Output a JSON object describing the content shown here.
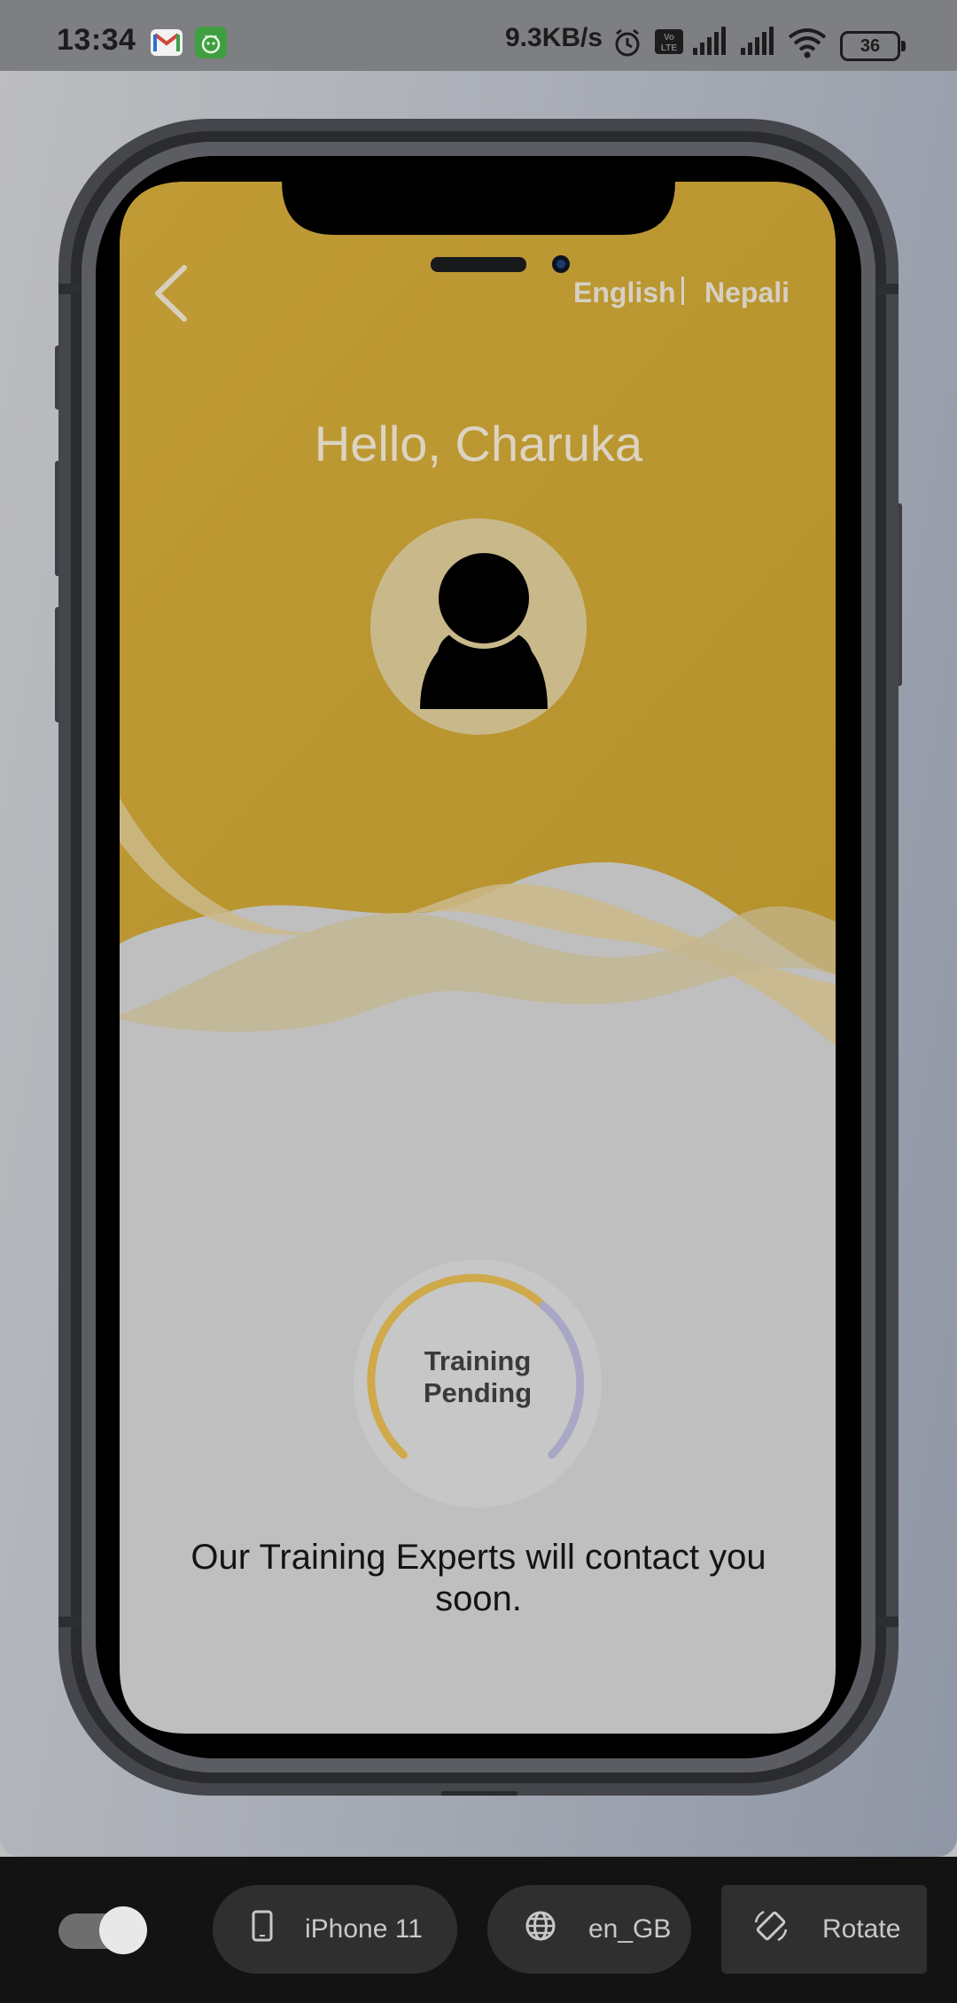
{
  "status_bar": {
    "time": "13:34",
    "network_speed": "9.3KB/s",
    "battery_level": "36",
    "icons": [
      "gmail-icon",
      "android-app-icon",
      "alarm-icon",
      "volte-icon",
      "signal-icon",
      "signal-icon",
      "wifi-icon",
      "battery-icon"
    ]
  },
  "app": {
    "language_options": {
      "english": "English",
      "nepali": "Nepali"
    },
    "greeting": "Hello, Charuka",
    "training_status": {
      "label_line1": "Training",
      "label_line2": "Pending"
    },
    "message": "Our Training Experts will contact you soon.",
    "colors": {
      "header": "#b9962f",
      "avatar_bg": "#c9b98a",
      "progress_gold": "#cfa94a",
      "progress_lavender": "#a9a7c6"
    }
  },
  "toolbar": {
    "toggle_on": true,
    "device_label": "iPhone 11",
    "locale_label": "en_GB",
    "rotate_label": "Rotate"
  }
}
